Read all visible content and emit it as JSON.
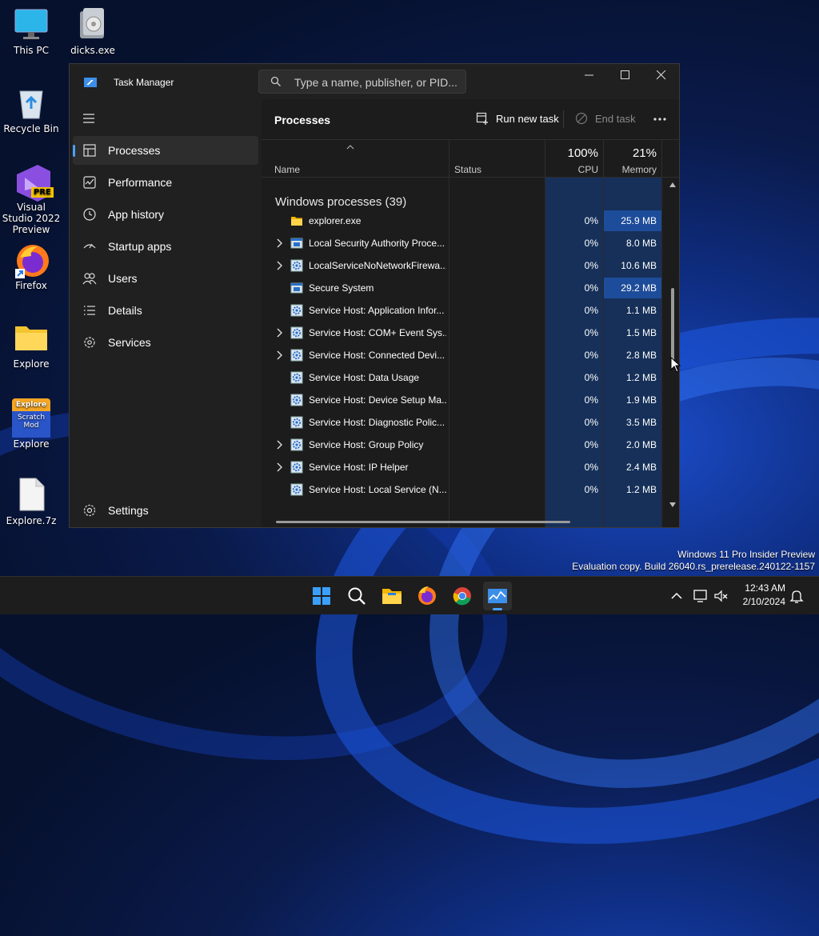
{
  "desktop": {
    "icons": [
      {
        "label": "This PC"
      },
      {
        "label": "dicks.exe"
      },
      {
        "label": "Recycle Bin"
      },
      {
        "label": "Visual Studio 2022 Preview",
        "badge": "PRE"
      },
      {
        "label": "Firefox"
      },
      {
        "label": "Explore"
      },
      {
        "label": "Explore",
        "overlay_top": "Explore",
        "overlay_text": "Scratch Mod"
      },
      {
        "label": "Explore.7z"
      }
    ]
  },
  "window": {
    "title": "Task Manager",
    "search_placeholder": "Type a name, publisher, or PID..."
  },
  "sidebar": {
    "items": [
      {
        "label": "Processes",
        "icon": "processes-icon",
        "active": true
      },
      {
        "label": "Performance",
        "icon": "performance-icon"
      },
      {
        "label": "App history",
        "icon": "app-history-icon"
      },
      {
        "label": "Startup apps",
        "icon": "startup-apps-icon"
      },
      {
        "label": "Users",
        "icon": "users-icon"
      },
      {
        "label": "Details",
        "icon": "details-icon"
      },
      {
        "label": "Services",
        "icon": "services-icon"
      }
    ],
    "settings_label": "Settings"
  },
  "main": {
    "title": "Processes",
    "run_new_task": "Run new task",
    "end_task": "End task",
    "columns": {
      "name": "Name",
      "status": "Status",
      "cpu_pct": "100%",
      "cpu": "CPU",
      "mem_pct": "21%",
      "memory": "Memory"
    },
    "group_label": "Windows processes (39)",
    "rows": [
      {
        "name": "explorer.exe",
        "cpu": "0%",
        "mem": "25.9 MB",
        "expand": false,
        "icon": "folder-icon",
        "highlight": true
      },
      {
        "name": "Local Security Authority Proce...",
        "cpu": "0%",
        "mem": "8.0 MB",
        "expand": true,
        "icon": "window-app-icon",
        "highlight": false
      },
      {
        "name": "LocalServiceNoNetworkFirewa...",
        "cpu": "0%",
        "mem": "10.6 MB",
        "expand": true,
        "icon": "service-gear-icon",
        "highlight": false
      },
      {
        "name": "Secure System",
        "cpu": "0%",
        "mem": "29.2 MB",
        "expand": false,
        "icon": "window-app-icon",
        "highlight": true
      },
      {
        "name": "Service Host: Application Infor...",
        "cpu": "0%",
        "mem": "1.1 MB",
        "expand": false,
        "icon": "service-gear-icon",
        "highlight": false
      },
      {
        "name": "Service Host: COM+ Event Sys...",
        "cpu": "0%",
        "mem": "1.5 MB",
        "expand": true,
        "icon": "service-gear-icon",
        "highlight": false
      },
      {
        "name": "Service Host: Connected Devi...",
        "cpu": "0%",
        "mem": "2.8 MB",
        "expand": true,
        "icon": "service-gear-icon",
        "highlight": false
      },
      {
        "name": "Service Host: Data Usage",
        "cpu": "0%",
        "mem": "1.2 MB",
        "expand": false,
        "icon": "service-gear-icon",
        "highlight": false
      },
      {
        "name": "Service Host: Device Setup Ma...",
        "cpu": "0%",
        "mem": "1.9 MB",
        "expand": false,
        "icon": "service-gear-icon",
        "highlight": false
      },
      {
        "name": "Service Host: Diagnostic Polic...",
        "cpu": "0%",
        "mem": "3.5 MB",
        "expand": false,
        "icon": "service-gear-icon",
        "highlight": false
      },
      {
        "name": "Service Host: Group Policy",
        "cpu": "0%",
        "mem": "2.0 MB",
        "expand": true,
        "icon": "service-gear-icon",
        "highlight": false
      },
      {
        "name": "Service Host: IP Helper",
        "cpu": "0%",
        "mem": "2.4 MB",
        "expand": true,
        "icon": "service-gear-icon",
        "highlight": false
      },
      {
        "name": "Service Host: Local Service (N...",
        "cpu": "0%",
        "mem": "1.2 MB",
        "expand": false,
        "icon": "service-gear-icon",
        "highlight": false
      }
    ]
  },
  "watermark": {
    "line1": "Windows 11 Pro Insider Preview",
    "line2": "Evaluation copy. Build 26040.rs_prerelease.240122-1157"
  },
  "taskbar": {
    "apps": [
      "windows-start-icon",
      "search-icon",
      "file-explorer-icon",
      "firefox-icon",
      "chrome-icon",
      "task-manager-icon"
    ],
    "time": "12:43 AM",
    "date": "2/10/2024"
  },
  "colors": {
    "accent": "#4aa0ff",
    "window_bg": "#202020",
    "column_heat": "#163059",
    "memory_highlight": "#1d4c9a"
  }
}
